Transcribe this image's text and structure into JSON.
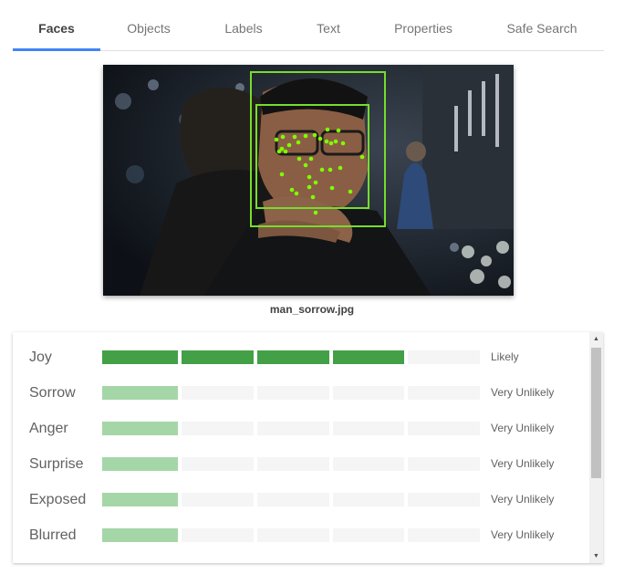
{
  "tabs": [
    {
      "label": "Faces",
      "active": true
    },
    {
      "label": "Objects",
      "active": false
    },
    {
      "label": "Labels",
      "active": false
    },
    {
      "label": "Text",
      "active": false
    },
    {
      "label": "Properties",
      "active": false
    },
    {
      "label": "Safe Search",
      "active": false
    }
  ],
  "image": {
    "filename": "man_sorrow.jpg"
  },
  "likelihoods": [
    {
      "label": "Joy",
      "value": "Likely",
      "level": 4,
      "max": 5
    },
    {
      "label": "Sorrow",
      "value": "Very Unlikely",
      "level": 1,
      "max": 5
    },
    {
      "label": "Anger",
      "value": "Very Unlikely",
      "level": 1,
      "max": 5
    },
    {
      "label": "Surprise",
      "value": "Very Unlikely",
      "level": 1,
      "max": 5
    },
    {
      "label": "Exposed",
      "value": "Very Unlikely",
      "level": 1,
      "max": 5
    },
    {
      "label": "Blurred",
      "value": "Very Unlikely",
      "level": 1,
      "max": 5
    }
  ],
  "colors": {
    "accent": "#4285f4",
    "bar_strong": "#43a047",
    "bar_light": "#a5d6a7",
    "bar_empty": "#f5f5f5",
    "face_box": "#76dd2b",
    "landmark": "#7fff00"
  },
  "icons": {
    "scroll_up": "scroll-up-arrow-icon",
    "scroll_down": "scroll-down-arrow-icon"
  }
}
